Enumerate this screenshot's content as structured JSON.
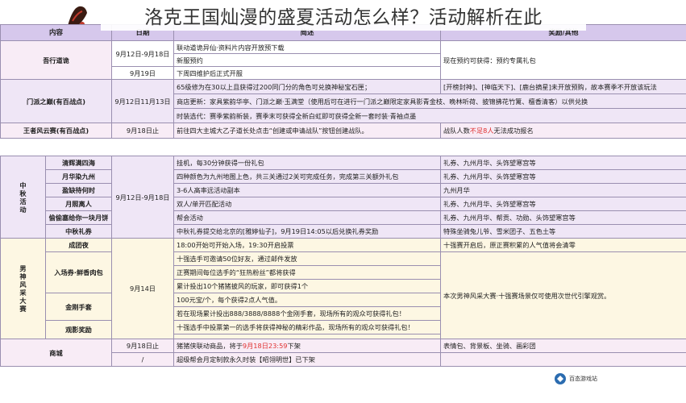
{
  "overlay_title": "洛克王国灿漫的盛夏活动怎么样？活动解析在此",
  "watermark_text": "百态游戏站",
  "headers": {
    "col1": "内容",
    "col2": "日期",
    "col3": "简述",
    "col4": "奖励/其他"
  },
  "rows": [
    {
      "category": "吾行道诡",
      "date": "9月12日-9月18日",
      "desc": "联动道诡异仙·资料片内容开放预下载",
      "reward": ""
    },
    {
      "category": "",
      "date": "",
      "desc": "新服预约",
      "reward": "现在预约可获得：预约专属礼包"
    },
    {
      "category": "",
      "date": "9月19日",
      "desc": "下周四维护后正式开服",
      "reward": ""
    },
    {
      "category": "门派之巅(有百战点)",
      "date": "9月12日11月13日",
      "desc": "65级修为在30以上且获得过200同门分的角色可兑换神秘宝石匣；",
      "reward": "[开榜封神]、[神临天下]、[鹿台摘星]未开放预购，故本赛季不开放该玩法"
    },
    {
      "category": "",
      "date": "",
      "desc": "商店更新：家具紫韵华亭、门派之巅·玉满堂（使用后可在进行一门派之巅限定家具影青金枝、晚林听荷、披锦拂花竹篱、檀香清客）以供兑换",
      "reward": ""
    },
    {
      "category": "",
      "date": "",
      "desc": "时装选代：赛季紫韵新装，赛季末可获得全新白虹即可获得全新一套时装·青袖点墨",
      "reward": ""
    },
    {
      "category": "王者风云赛(有百战点)",
      "date": "9月18日止",
      "desc": "前往四大主城大乙子道长处点击“创建或申请战队”按钮创建战队。",
      "reward_prefix": "战队人数",
      "reward_red": "不足8人",
      "reward_suffix": "无法成功报名"
    },
    {
      "category": "清辉满四海",
      "date": "9月12日-9月18日",
      "desc": "挂机，每30分钟获得一份礼包",
      "reward": "礼券、九州月华、头饰望寒宫等"
    },
    {
      "category": "月华染九州",
      "date": "",
      "desc": "四种颜色为九州地图上色，共三关通过2关可完成任务，完成第三关额外礼包",
      "reward": "礼券、九州月华、头饰望寒宫等"
    },
    {
      "category": "盈缺待何时",
      "date": "",
      "desc": "3-6人高率远活动副本",
      "reward": "九州月华"
    },
    {
      "category": "月照离人",
      "date": "",
      "desc": "双人/单开匹配活动",
      "reward": "礼券、九州月华、头饰望寒宫等"
    },
    {
      "category": "偷偷塞给你一块月饼",
      "date": "",
      "desc": "帮会活动",
      "reward": "礼券、九州月华、帮贡、功勋、头饰望寒宫等"
    },
    {
      "category": "中秋礼券",
      "date": "",
      "desc": "中秋礼券提交给北京的[雅婷仙子]，9月19日14:05以后兑换礼券奖励",
      "reward": "特殊坐骑兔儿爷、雪米团子、五色土等"
    },
    {
      "category": "成团夜",
      "date": "9月14日",
      "desc": "18:00开始可开始入场，19:30开启投票",
      "reward": "十强赛开启后，原正赛积累的人气值将会清零"
    },
    {
      "category": "入场券·鲜香肉包",
      "date": "",
      "desc": "十强选手可邀请50位好友，通过邮件发放",
      "reward": ""
    },
    {
      "category": "",
      "date": "",
      "desc": "正赛期间每位选手的“狂热粉丝”都将获得",
      "reward": ""
    },
    {
      "category": "金刚手套",
      "date": "",
      "desc": "累计投出10个猪猪披风的玩家，即可获得1个",
      "reward": "本次男神风采大赛·十强赛场景仅可使用次世代引擎观赏。"
    },
    {
      "category": "",
      "date": "",
      "desc": "100元宝/个，每个获得2点人气值。",
      "reward": ""
    },
    {
      "category": "观影奖励",
      "date": "",
      "desc": "若在现场累计投出888/3888/8888个金刚手套，现场所有的观众可获得礼包！",
      "reward": ""
    },
    {
      "category": "",
      "date": "",
      "desc": "十强选手中投票第一的选手将获得神秘的精彩作品，现场所有的观众可获得礼包！",
      "reward": ""
    },
    {
      "category": "商城",
      "date": "9月18日止",
      "desc_prefix": "猪猪侠联动商品，将于",
      "desc_red": "9月18日23:59",
      "desc_suffix": "下架",
      "reward": "表情包、背景板、坐骑、画彩团"
    },
    {
      "category": "",
      "date": "/",
      "desc": "超级帮会月定制款永久时装【昭翎明世】已下架",
      "reward": ""
    }
  ],
  "groups": {
    "mid_autumn": [
      "中",
      "秋",
      "活",
      "动"
    ],
    "male_contest": [
      "男",
      "神",
      "风",
      "采",
      "大",
      "赛"
    ]
  },
  "colors": {
    "header": "#d6c8ec",
    "pink": "#f8ecf6",
    "mauve": "#efe6f6",
    "yellow": "#fdf7e3",
    "red": "#e03131",
    "border": "#9a8fb0"
  }
}
